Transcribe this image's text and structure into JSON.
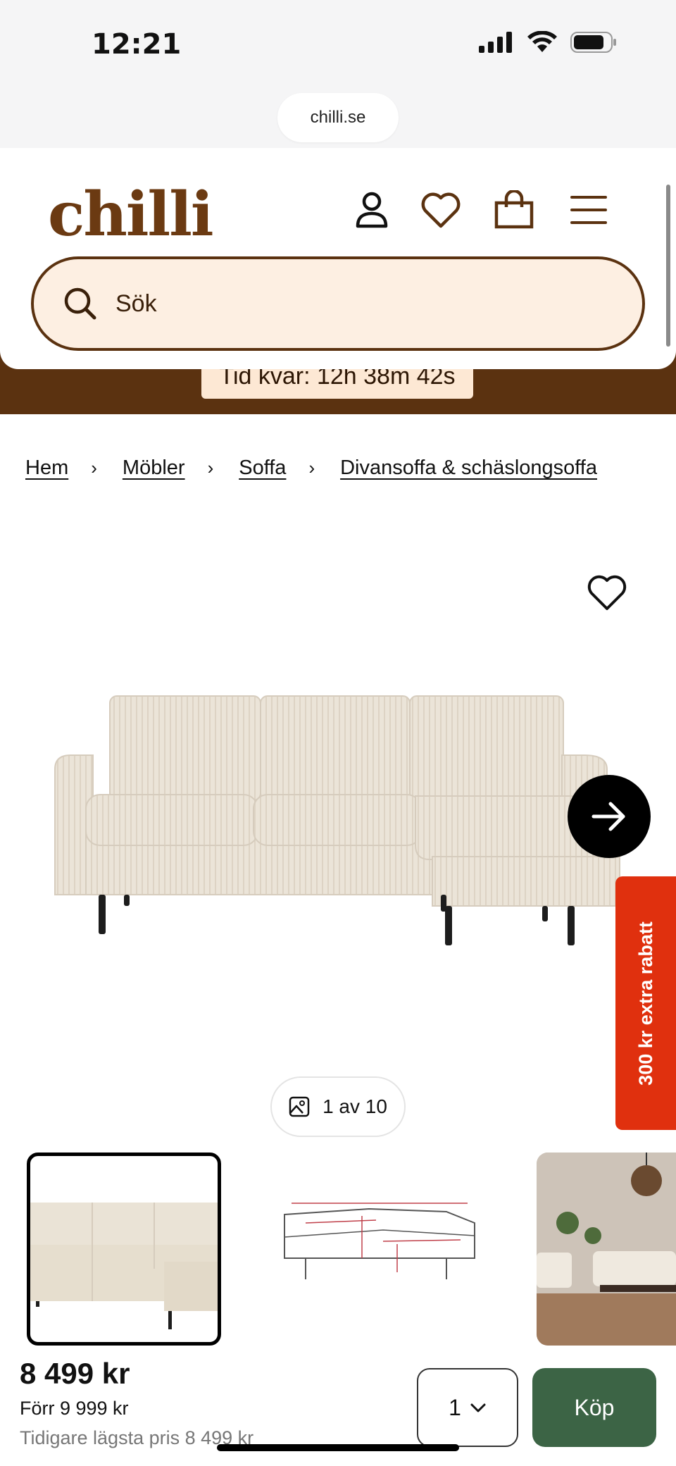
{
  "status_bar": {
    "time": "12:21"
  },
  "browser": {
    "url": "chilli.se"
  },
  "header": {
    "logo": "chilli",
    "search_placeholder": "Sök"
  },
  "countdown": {
    "text": "Tid kvar: 12h 38m 42s"
  },
  "breadcrumb": {
    "items": [
      "Hem",
      "Möbler",
      "Soffa",
      "Divansoffa & schäslongsoffa"
    ],
    "separator": "›"
  },
  "gallery": {
    "counter": "1 av 10",
    "promo": "300 kr extra rabatt"
  },
  "product": {
    "price": "8 499 kr",
    "before_price": "Förr 9 999 kr",
    "lowest_price": "Tidigare lägsta pris 8 499 kr",
    "quantity": "1",
    "buy_label": "Köp"
  },
  "colors": {
    "brand": "#6b3a12",
    "search_bg": "#fdefe2",
    "promo": "#e0300e",
    "buy": "#3c6445"
  }
}
